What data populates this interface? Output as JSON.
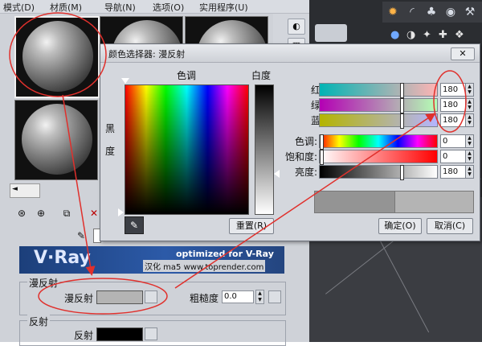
{
  "menu": {
    "items": [
      "模式(D)",
      "材质(M)",
      "导航(N)",
      "选项(O)",
      "实用程序(U)"
    ]
  },
  "dialog": {
    "title": "颜色选择器: 漫反射",
    "close_icon": "close-icon",
    "hue_label": "色调",
    "white_label": "白度",
    "black_label": "黑",
    "black_label_2": "度",
    "reset_label": "重置(R)",
    "ok_label": "确定(O)",
    "cancel_label": "取消(C)",
    "rows": [
      {
        "label": "红:",
        "value": "180",
        "fraction": 0.706,
        "gradient": "linear-gradient(90deg,#00b4b4,#ffb4b4)"
      },
      {
        "label": "绿:",
        "value": "180",
        "fraction": 0.706,
        "gradient": "linear-gradient(90deg,#b400b4,#b4ffb4)"
      },
      {
        "label": "蓝:",
        "value": "180",
        "fraction": 0.706,
        "gradient": "linear-gradient(90deg,#b4b400,#b4b4ff)"
      },
      {
        "label": "色调:",
        "value": "0",
        "fraction": 0.0,
        "gradient": "linear-gradient(90deg,#ff0000,#ffff00,#00ff00,#00ffff,#0000ff,#ff00ff,#ff0000)"
      },
      {
        "label": "饱和度:",
        "value": "0",
        "fraction": 0.0,
        "gradient": "linear-gradient(90deg,#ffffff,#ff0000)"
      },
      {
        "label": "亮度:",
        "value": "180",
        "fraction": 0.706,
        "gradient": "linear-gradient(90deg,#000000,#ffffff)"
      }
    ],
    "preview_old_color": "#949494",
    "preview_new_color": "#b4b4b4"
  },
  "vray": {
    "logo": "V·Ray",
    "tagline": "optimized for V-Ray",
    "credit": "汉化 ma5 www.toprender.com"
  },
  "diffuse_group": {
    "title": "漫反射",
    "diffuse_label": "漫反射",
    "diffuse_color": "#b4b4b4",
    "roughness_label": "粗糙度",
    "roughness_value": "0.0"
  },
  "reflect_group": {
    "title": "反射",
    "reflect_label": "反射",
    "reflect_color": "#000000"
  },
  "colors": {
    "annotation": "#e0302c",
    "accent": "#3a6fd8"
  }
}
